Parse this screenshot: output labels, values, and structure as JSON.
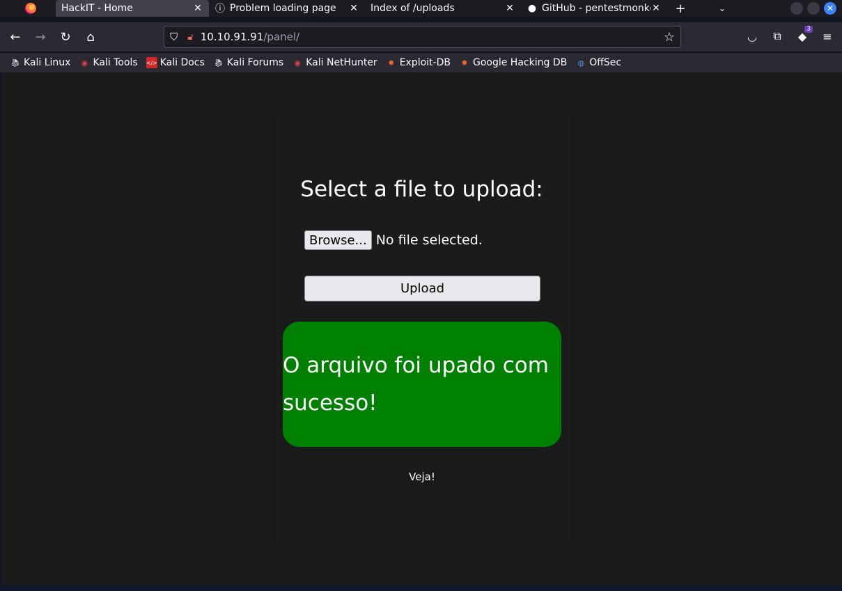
{
  "browser": {
    "tabs": [
      {
        "title": "HackIT - Home",
        "icon": "none",
        "active": true
      },
      {
        "title": "Problem loading page",
        "icon": "info-icon",
        "active": false
      },
      {
        "title": "Index of /uploads",
        "icon": "none",
        "active": false
      },
      {
        "title": "GitHub - pentestmonkey/",
        "icon": "github-icon",
        "active": false
      }
    ],
    "url": {
      "host": "10.10.91.91",
      "path": "/panel/"
    },
    "extensions_badge": "3",
    "bookmarks": [
      {
        "label": "Kali Linux",
        "icon": "kali-dragon-icon"
      },
      {
        "label": "Kali Tools",
        "icon": "kali-tools-icon"
      },
      {
        "label": "Kali Docs",
        "icon": "kali-docs-icon"
      },
      {
        "label": "Kali Forums",
        "icon": "kali-dragon-icon"
      },
      {
        "label": "Kali NetHunter",
        "icon": "kali-tools-icon"
      },
      {
        "label": "Exploit-DB",
        "icon": "exploit-db-icon"
      },
      {
        "label": "Google Hacking DB",
        "icon": "exploit-db-icon"
      },
      {
        "label": "OffSec",
        "icon": "offsec-icon"
      }
    ]
  },
  "page": {
    "heading": "Select a file to upload:",
    "browse_label": "Browse...",
    "file_status": "No file selected.",
    "upload_label": "Upload",
    "success_message": "O arquivo foi upado com sucesso!",
    "link_text": "Veja!"
  },
  "colors": {
    "success_bg": "#008000",
    "page_bg": "#1a1a1a"
  }
}
